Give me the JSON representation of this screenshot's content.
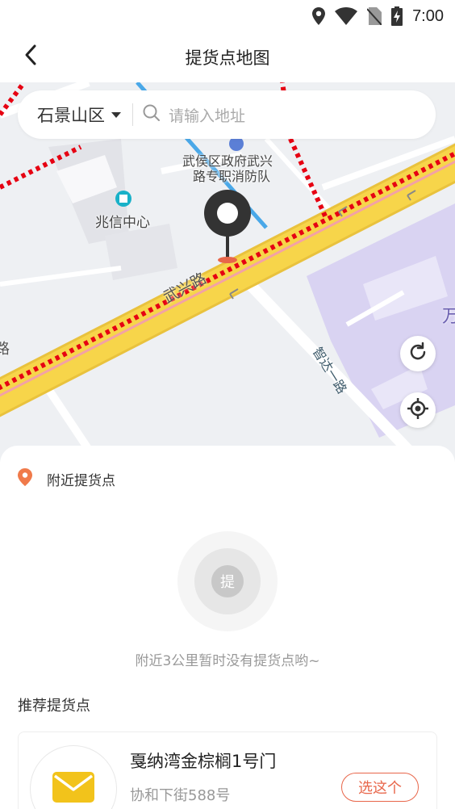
{
  "status_bar": {
    "time": "7:00",
    "icons": [
      "location-icon",
      "wifi-icon",
      "no-sim-icon",
      "battery-charging-icon"
    ]
  },
  "header": {
    "title": "提货点地图",
    "back_icon": "chevron-left-icon"
  },
  "map": {
    "search": {
      "district": "石景山区",
      "placeholder": "请输入地址"
    },
    "labels": {
      "poi_fire_station": "武侯区政府武兴路专职消防队",
      "poi_fire_line1": "武侯区政府武兴",
      "poi_fire_line2": "路专职消防队",
      "poi_building": "兆信中心",
      "road_main": "武兴路",
      "road_side": "智达一路",
      "edge_char_right": "万",
      "edge_char_left": "路"
    },
    "buttons": [
      "refresh-icon",
      "locate-icon"
    ],
    "colors": {
      "main_road": "#f7d54a",
      "red_dash": "#e60012",
      "campus": "#d9d3f2"
    }
  },
  "nearby": {
    "title": "附近提货点",
    "empty_icon_text": "提",
    "empty_message": "附近3公里暂时没有提货点哟~"
  },
  "recommend": {
    "title": "推荐提货点",
    "items": [
      {
        "name": "戛纳湾金棕榈1号门",
        "address": "协和下街588号",
        "action": "选这个",
        "logo_icon": "envelope-icon"
      }
    ]
  },
  "accent_color": "#e8664a"
}
